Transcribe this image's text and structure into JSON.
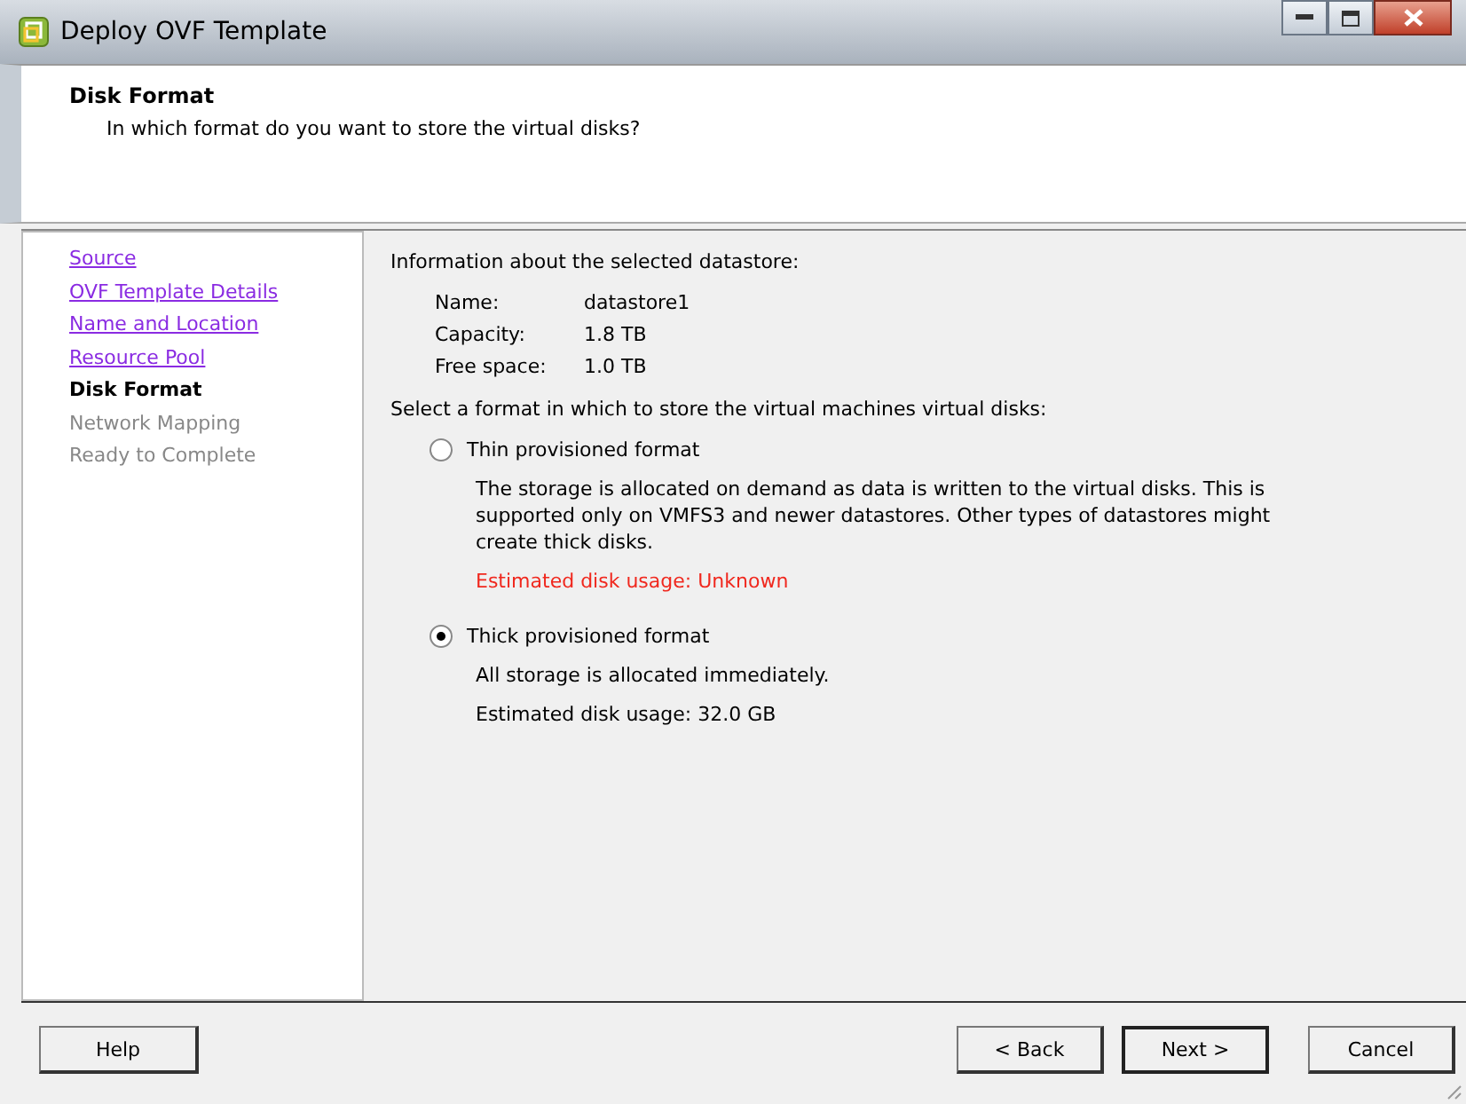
{
  "window": {
    "title": "Deploy OVF Template"
  },
  "header": {
    "title": "Disk Format",
    "subtitle": "In which format do you want to store the virtual disks?"
  },
  "steps": [
    {
      "label": "Source",
      "kind": "link"
    },
    {
      "label": "OVF Template Details",
      "kind": "link"
    },
    {
      "label": "Name and Location",
      "kind": "link"
    },
    {
      "label": "Resource Pool",
      "kind": "link"
    },
    {
      "label": "Disk Format",
      "kind": "current"
    },
    {
      "label": "Network Mapping",
      "kind": "pending"
    },
    {
      "label": "Ready to Complete",
      "kind": "pending"
    }
  ],
  "datastore": {
    "heading": "Information about the selected datastore:",
    "fields": [
      {
        "label": "Name:",
        "value": "datastore1"
      },
      {
        "label": "Capacity:",
        "value": "1.8 TB"
      },
      {
        "label": "Free space:",
        "value": "1.0 TB"
      }
    ]
  },
  "format_prompt": "Select a format in which to store the virtual machines virtual disks:",
  "formats": [
    {
      "label": "Thin provisioned format",
      "selected": false,
      "description": "The storage is allocated on demand as data is written to the virtual disks. This is supported only on VMFS3 and newer datastores. Other types of datastores might create thick disks.",
      "estimate": "Estimated disk usage: Unknown",
      "warning": true
    },
    {
      "label": "Thick provisioned format",
      "selected": true,
      "description": "All storage is allocated immediately.",
      "estimate": "Estimated disk usage: 32.0 GB",
      "warning": false
    }
  ],
  "buttons": {
    "help": "Help",
    "nav": [
      {
        "label": "< Back",
        "default": false
      },
      {
        "label": "Next >",
        "default": true
      },
      {
        "label": "Cancel",
        "default": false
      }
    ]
  }
}
